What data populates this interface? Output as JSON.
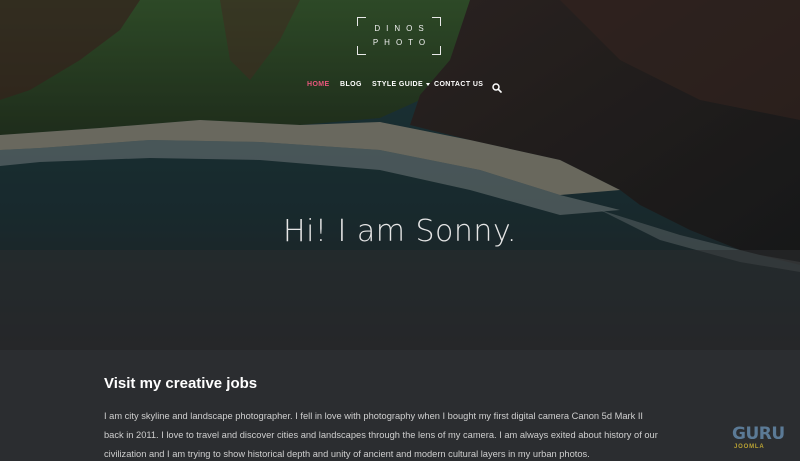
{
  "logo": {
    "line1": "DINOS",
    "line2": "PHOTO"
  },
  "nav": {
    "items": [
      {
        "label": "HOME"
      },
      {
        "label": "BLOG"
      },
      {
        "label": "STYLE GUIDE"
      },
      {
        "label": "CONTACT US"
      }
    ],
    "search_icon": "search-icon"
  },
  "hero": {
    "title": "Hi! I am Sonny."
  },
  "content": {
    "heading": "Visit my creative jobs",
    "paragraph": "I am city skyline and landscape photographer. I fell in love with photography when I bought my first digital camera Canon 5d Mark II back in 2011. I love to travel and discover cities and landscapes through the lens of my camera. I am always exited about history of our civilization and I am trying to show historical depth and unity of ancient and modern cultural layers in my urban photos."
  },
  "badge": {
    "line1": "GURU",
    "line2": "JOOMLA"
  },
  "colors": {
    "accent": "#e8567c",
    "background": "#2b2d30",
    "text": "#cfcfcf"
  }
}
